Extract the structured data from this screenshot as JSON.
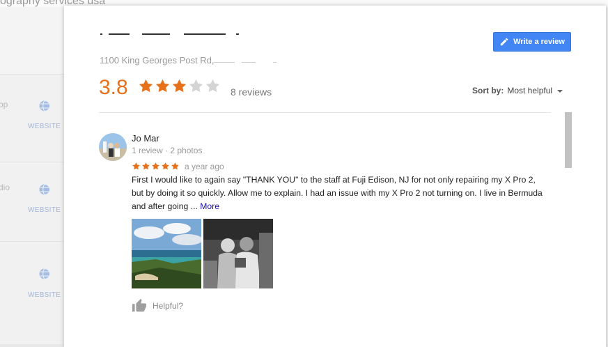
{
  "background": {
    "search_text": "ography services usa",
    "row_snippets": [
      "op",
      "dio"
    ],
    "website_label": "WEBSITE"
  },
  "dialog": {
    "address": "1100 King Georges Post Rd,",
    "write_review_label": "Write a review",
    "rating": "3.8",
    "rating_value": 3.8,
    "review_count": "8 reviews",
    "sort_label": "Sort by:",
    "sort_value": "Most helpful"
  },
  "review": {
    "reviewer_name": "Jo Mar",
    "reviewer_meta": "1 review · 2 photos",
    "stars": 5,
    "date": "a year ago",
    "text": "First I would like to again say \"THANK YOU\" to the staff at Fuji Edison, NJ for not only repairing my X Pro 2, but by doing it so quickly. Allow me to explain. I had an issue with my X Pro 2 not turning on. I live in Bermuda and after going ... ",
    "more_label": "More",
    "helpful_label": "Helpful?"
  },
  "colors": {
    "star_orange": "#e7711b",
    "star_gray": "#d4d4d4",
    "button_blue": "#4285f4",
    "link_blue": "#1a0dab"
  },
  "icons": {
    "write": "pencil-icon",
    "thumb": "thumbs-up-icon",
    "globe": "globe-icon",
    "sort": "caret-down-icon"
  }
}
